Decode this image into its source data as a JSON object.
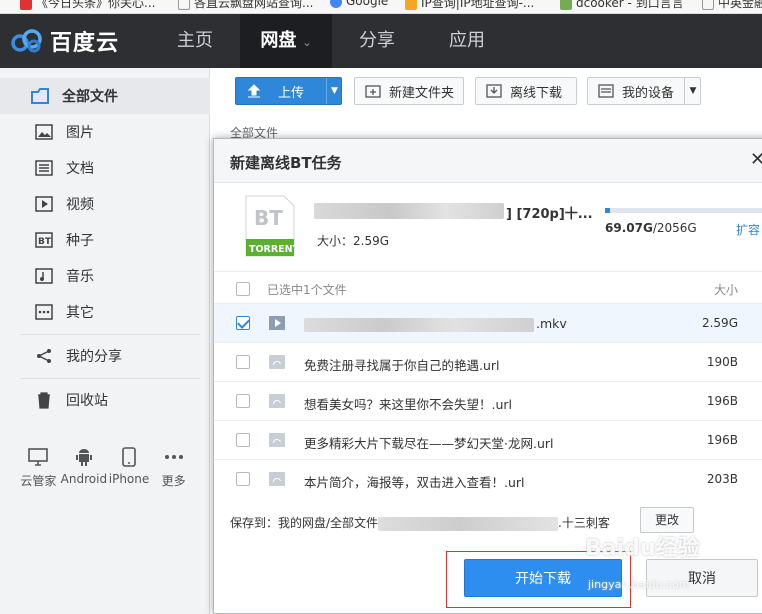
{
  "bookmarks": [
    "《今日头条》你关心...",
    "各直云飘盘网站查询...",
    "Google",
    "IP查询|IP地址查询-...",
    "dcooker - 到口言言",
    "中英金融"
  ],
  "app": {
    "logo_text": "百度云",
    "nav": [
      "主页",
      "网盘",
      "分享",
      "应用"
    ]
  },
  "sidebar": {
    "items": [
      {
        "label": "全部文件",
        "icon": "folder-icon"
      },
      {
        "label": "图片",
        "icon": "image-icon"
      },
      {
        "label": "文档",
        "icon": "document-icon"
      },
      {
        "label": "视频",
        "icon": "video-icon"
      },
      {
        "label": "种子",
        "icon": "bt-icon"
      },
      {
        "label": "音乐",
        "icon": "music-icon"
      },
      {
        "label": "其它",
        "icon": "more-icon"
      }
    ],
    "share": "我的分享",
    "trash": "回收站",
    "devices": [
      "云管家",
      "Android",
      "iPhone",
      "更多"
    ]
  },
  "toolbar": {
    "upload": "上传",
    "new_folder": "新建文件夹",
    "offline": "离线下载",
    "devices": "我的设备"
  },
  "crumb": "全部文件",
  "dialog": {
    "title": "新建离线BT任务",
    "torrent_label": "TORRENT",
    "torrent_badge": "BT",
    "file_tail": "] [720p]十...",
    "size_label": "大小：2.59G",
    "quota_used": "69.07G",
    "quota_total": "/2056G",
    "quota_fraction": 0.034,
    "expand": "扩容",
    "list_header": "已选中1个文件",
    "size_header": "大小",
    "files": [
      {
        "name": ".mkv",
        "size": "2.59G",
        "checked": true,
        "type": "video"
      },
      {
        "name": "免费注册寻找属于你自己的艳遇.url",
        "size": "190B",
        "checked": false,
        "type": "link"
      },
      {
        "name": "想看美女吗？来这里你不会失望！.url",
        "size": "196B",
        "checked": false,
        "type": "link"
      },
      {
        "name": "更多精彩大片下载尽在——梦幻天堂·龙网.url",
        "size": "196B",
        "checked": false,
        "type": "link"
      },
      {
        "name": "本片简介，海报等，双击进入查看！.url",
        "size": "203B",
        "checked": false,
        "type": "link"
      }
    ],
    "save_to_prefix": "保存到：我的网盘/全部文件",
    "save_to_suffix": ".十三刺客",
    "change": "更改",
    "start": "开始下载",
    "cancel": "取消"
  },
  "watermark": {
    "main": "Baidu经验",
    "sub": "jingyan.baidu.com"
  },
  "colors": {
    "accent": "#2e87d8",
    "topbar": "#2d2f33"
  }
}
